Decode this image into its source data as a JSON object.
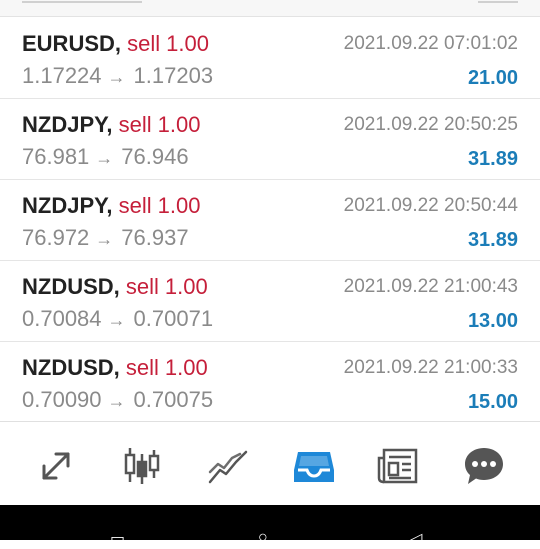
{
  "trades": [
    {
      "symbol": "EURUSD",
      "type": "sell",
      "volume": "1.00",
      "open_price": "1.17224",
      "current_price": "1.17203",
      "time": "2021.09.22 07:01:02",
      "profit": "21.00"
    },
    {
      "symbol": "NZDJPY",
      "type": "sell",
      "volume": "1.00",
      "open_price": "76.981",
      "current_price": "76.946",
      "time": "2021.09.22 20:50:25",
      "profit": "31.89"
    },
    {
      "symbol": "NZDJPY",
      "type": "sell",
      "volume": "1.00",
      "open_price": "76.972",
      "current_price": "76.937",
      "time": "2021.09.22 20:50:44",
      "profit": "31.89"
    },
    {
      "symbol": "NZDUSD",
      "type": "sell",
      "volume": "1.00",
      "open_price": "0.70084",
      "current_price": "0.70071",
      "time": "2021.09.22 21:00:43",
      "profit": "13.00"
    },
    {
      "symbol": "NZDUSD",
      "type": "sell",
      "volume": "1.00",
      "open_price": "0.70090",
      "current_price": "0.70075",
      "time": "2021.09.22 21:00:33",
      "profit": "15.00"
    }
  ],
  "colors": {
    "sell": "#c51f3a",
    "profit": "#1b7db8",
    "active_tab": "#1e88d8",
    "icon": "#555555"
  },
  "toolbar": {
    "items": [
      {
        "icon": "quotes-arrows-icon",
        "active": false
      },
      {
        "icon": "candlestick-chart-icon",
        "active": false
      },
      {
        "icon": "line-chart-icon",
        "active": false
      },
      {
        "icon": "inbox-trade-icon",
        "active": true
      },
      {
        "icon": "news-icon",
        "active": false
      },
      {
        "icon": "chat-icon",
        "active": false
      }
    ]
  }
}
